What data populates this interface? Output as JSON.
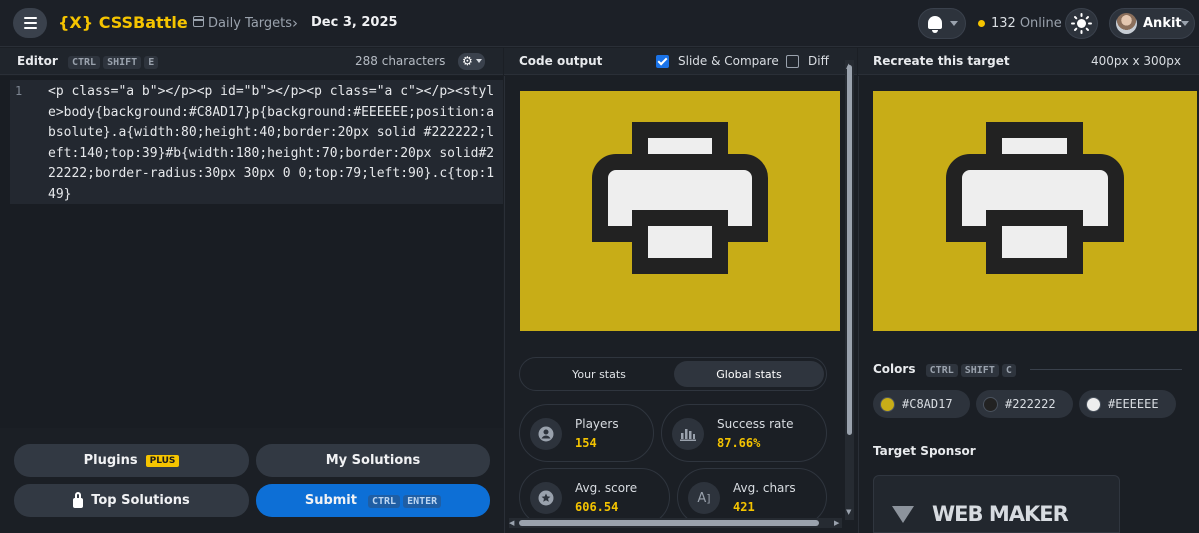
{
  "header": {
    "logo": "{X} CSSBattle",
    "crumb_section": "Daily Targets",
    "crumb_date": "Dec 3, 2025",
    "online_count": "132",
    "online_label": "Online",
    "user_name": "Ankit"
  },
  "editor": {
    "title": "Editor",
    "shortcut": [
      "CTRL",
      "SHIFT",
      "E"
    ],
    "char_count": "288 characters",
    "line_number": "1",
    "code_line": "<p class=\"a b\"></p><p id=\"b\"></p><p class=\"a c\"></p><style>body{background:#C8AD17}p{background:#EEEEEE;position:absolute}.a{width:80;height:40;border:20px solid #222222;left:140;top:39}#b{width:180;height:70;border:20px solid#222222;border-radius:30px 30px 0 0;top:79;left:90}.c{top:149}"
  },
  "buttons": {
    "plugins": "Plugins",
    "plugins_badge": "PLUS",
    "my_solutions": "My Solutions",
    "top_solutions": "Top Solutions",
    "submit": "Submit",
    "submit_shortcut": [
      "CTRL",
      "ENTER"
    ]
  },
  "output": {
    "title": "Code output",
    "slide_compare": "Slide & Compare",
    "slide_compare_checked": true,
    "diff": "Diff",
    "diff_checked": false
  },
  "stats": {
    "tabs": [
      "Your stats",
      "Global stats"
    ],
    "active_tab": "Global stats",
    "items": [
      {
        "label": "Players",
        "value": "154",
        "icon": "user-icon"
      },
      {
        "label": "Success rate",
        "value": "87.66%",
        "icon": "bar-chart-icon"
      },
      {
        "label": "Avg. score",
        "value": "606.54",
        "icon": "star-icon"
      },
      {
        "label": "Avg. chars",
        "value": "421",
        "icon": "text-size-icon"
      }
    ]
  },
  "target": {
    "title": "Recreate this target",
    "size": "400px x 300px",
    "colors_title": "Colors",
    "colors_shortcut": [
      "CTRL",
      "SHIFT",
      "C"
    ],
    "colors": [
      {
        "hex": "#C8AD17"
      },
      {
        "hex": "#222222"
      },
      {
        "hex": "#EEEEEE"
      }
    ],
    "sponsor_title": "Target Sponsor",
    "sponsor_name": "WEB MAKER"
  }
}
